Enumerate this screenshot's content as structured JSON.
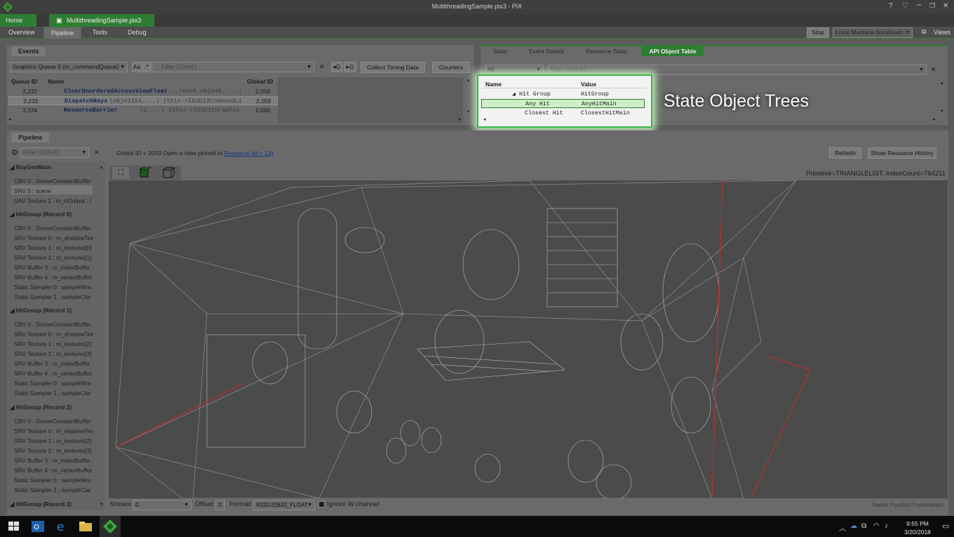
{
  "window": {
    "title": "MultithreadingSample.pix3 - PIX"
  },
  "titlebar_icons": [
    "help-icon",
    "feedback-icon",
    "minimize-icon",
    "maximize-icon",
    "close-icon"
  ],
  "tabs": {
    "home": "Home",
    "file": "MultithreadingSample.pix3",
    "close": "✕"
  },
  "nav": {
    "items": [
      "Overview",
      "Pipeline",
      "Tools",
      "Debug"
    ],
    "stop": "Stop",
    "machine": "Local Machine (localhost)",
    "views": "Views"
  },
  "events": {
    "title": "Events",
    "queue": "Graphics Queue 0 (m_commandQueue)",
    "case_btn": "Aa",
    "regex_btn": ".*",
    "filter_placeholder": "Filter (Ctrl+E)",
    "clear": "✕",
    "nav_btn": "G",
    "collect_btn": "Collect Timing Data",
    "counters_btn": "Counters",
    "columns": {
      "queue_id": "Queue ID",
      "name": "Name",
      "global_id": "Global ID"
    },
    "rows": [
      {
        "queue_id": "3,232",
        "name": "ClearUnorderedAccessViewFloat",
        "args": "(...,res#6,obj#40,...,0,",
        "global_id": "2,058"
      },
      {
        "queue_id": "3,233",
        "name": "DispatchRays",
        "args": "(obj#1154,...)  {this->ID3D12CommandListR",
        "global_id": "2,059"
      },
      {
        "queue_id": "3,234",
        "name": "ResourceBarrier",
        "args": "(2,...)  {this->ID3D12GraphicsCommandL",
        "global_id": "2,060"
      }
    ]
  },
  "right_tabs": [
    "State",
    "Event Details",
    "Resource Table",
    "API Object Table"
  ],
  "api_table": {
    "filter_all": "All",
    "filter_placeholder": "Filter (Ctrl+E)",
    "columns": {
      "name": "Name",
      "value": "Value"
    },
    "rows": [
      {
        "name": "Hit Group",
        "value": "HitGroup"
      },
      {
        "name": "Any Hit",
        "value": "AnyHitMain"
      },
      {
        "name": "Closest Hit",
        "value": "ClosestHitMain"
      }
    ],
    "annotation": "State Object Trees"
  },
  "pipeline": {
    "title": "Pipeline",
    "filter_placeholder": "Filter (Ctrl+E)",
    "info_prefix": "Global ID = 2059   Open a view pinned to",
    "info_link": "Resource (id = 13)",
    "info_suffix": ".",
    "refresh": "Refresh",
    "show_history": "Show Resource History",
    "primitive": "Primitive=TRIANGLELIST, IndexCount=764211",
    "groups": [
      {
        "header": "RayGenMain",
        "items": [
          "CBV 0 : SceneConstantBuffer",
          "SRV 5 : scene",
          "UAV Texture 1 : m_rtOutput : l"
        ]
      },
      {
        "header": "HitGroup (Record 0)",
        "items": [
          "CBV 0 : SceneConstantBuffer",
          "SRV Texture 0 : m_shadowTex",
          "SRV Texture 1 : m_textures[0]",
          "SRV Texture 2 : m_textures[1]",
          "SRV Buffer 3 : m_indexBuffer :",
          "SRV Buffer 4 : m_vertexBuffer",
          "Static Sampler 0 : sampleWra",
          "Static Sampler 1 : sampleClar"
        ]
      },
      {
        "header": "HitGroup (Record 1)",
        "items": [
          "CBV 0 : SceneConstantBuffer",
          "SRV Texture 0 : m_shadowTex",
          "SRV Texture 1 : m_textures[2]",
          "SRV Texture 2 : m_textures[3]",
          "SRV Buffer 3 : m_indexBuffer :",
          "SRV Buffer 4 : m_vertexBuffer",
          "Static Sampler 0 : sampleWra",
          "Static Sampler 1 : sampleClar"
        ]
      },
      {
        "header": "HitGroup (Record 2)",
        "items": [
          "CBV 0 : SceneConstantBuffer",
          "SRV Texture 0 : m_shadowTex",
          "SRV Texture 1 : m_textures[2]",
          "SRV Texture 2 : m_textures[3]",
          "SRV Buffer 3 : m_indexBuffer :",
          "SRV Buffer 4 : m_vertexBuffer",
          "Static Sampler 0 : sampleWra",
          "Static Sampler 1 : sampleClar"
        ]
      },
      {
        "header": "HitGroup (Record 3)",
        "items": []
      }
    ],
    "bottom": {
      "stream_label": "Stream:",
      "stream_value": "0",
      "offset_label": "Offset:",
      "offset_value": "0",
      "format_label": "Format:",
      "format_value": "R32G32B32_FLOAT",
      "ignore_w": "Ignore W channel",
      "reset": "Reset Position Parameters"
    }
  },
  "taskbar": {
    "time": "9:55 PM",
    "date": "3/20/2018"
  }
}
